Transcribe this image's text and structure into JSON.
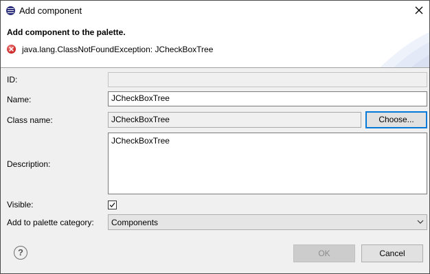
{
  "window": {
    "title": "Add component"
  },
  "header": {
    "title": "Add component to the palette.",
    "message": "java.lang.ClassNotFoundException: JCheckBoxTree"
  },
  "form": {
    "id": {
      "label": "ID:",
      "value": ""
    },
    "name": {
      "label": "Name:",
      "value": "JCheckBoxTree"
    },
    "class_name": {
      "label": "Class name:",
      "value": "JCheckBoxTree",
      "choose_label": "Choose..."
    },
    "description": {
      "label": "Description:",
      "value": "JCheckBoxTree"
    },
    "visible": {
      "label": "Visible:",
      "checked": true
    },
    "category": {
      "label": "Add to palette category:",
      "selected": "Components"
    }
  },
  "footer": {
    "help_glyph": "?",
    "ok_label": "OK",
    "cancel_label": "Cancel"
  },
  "icons": {
    "title": "eclipse-icon",
    "close": "close-icon",
    "error": "error-icon",
    "check": "check-icon",
    "dropdown": "chevron-down-icon",
    "help": "help-icon"
  },
  "colors": {
    "focus_border": "#0078d7",
    "error_icon": "#c81e1e",
    "dialog_bg": "#f0f0f0"
  }
}
